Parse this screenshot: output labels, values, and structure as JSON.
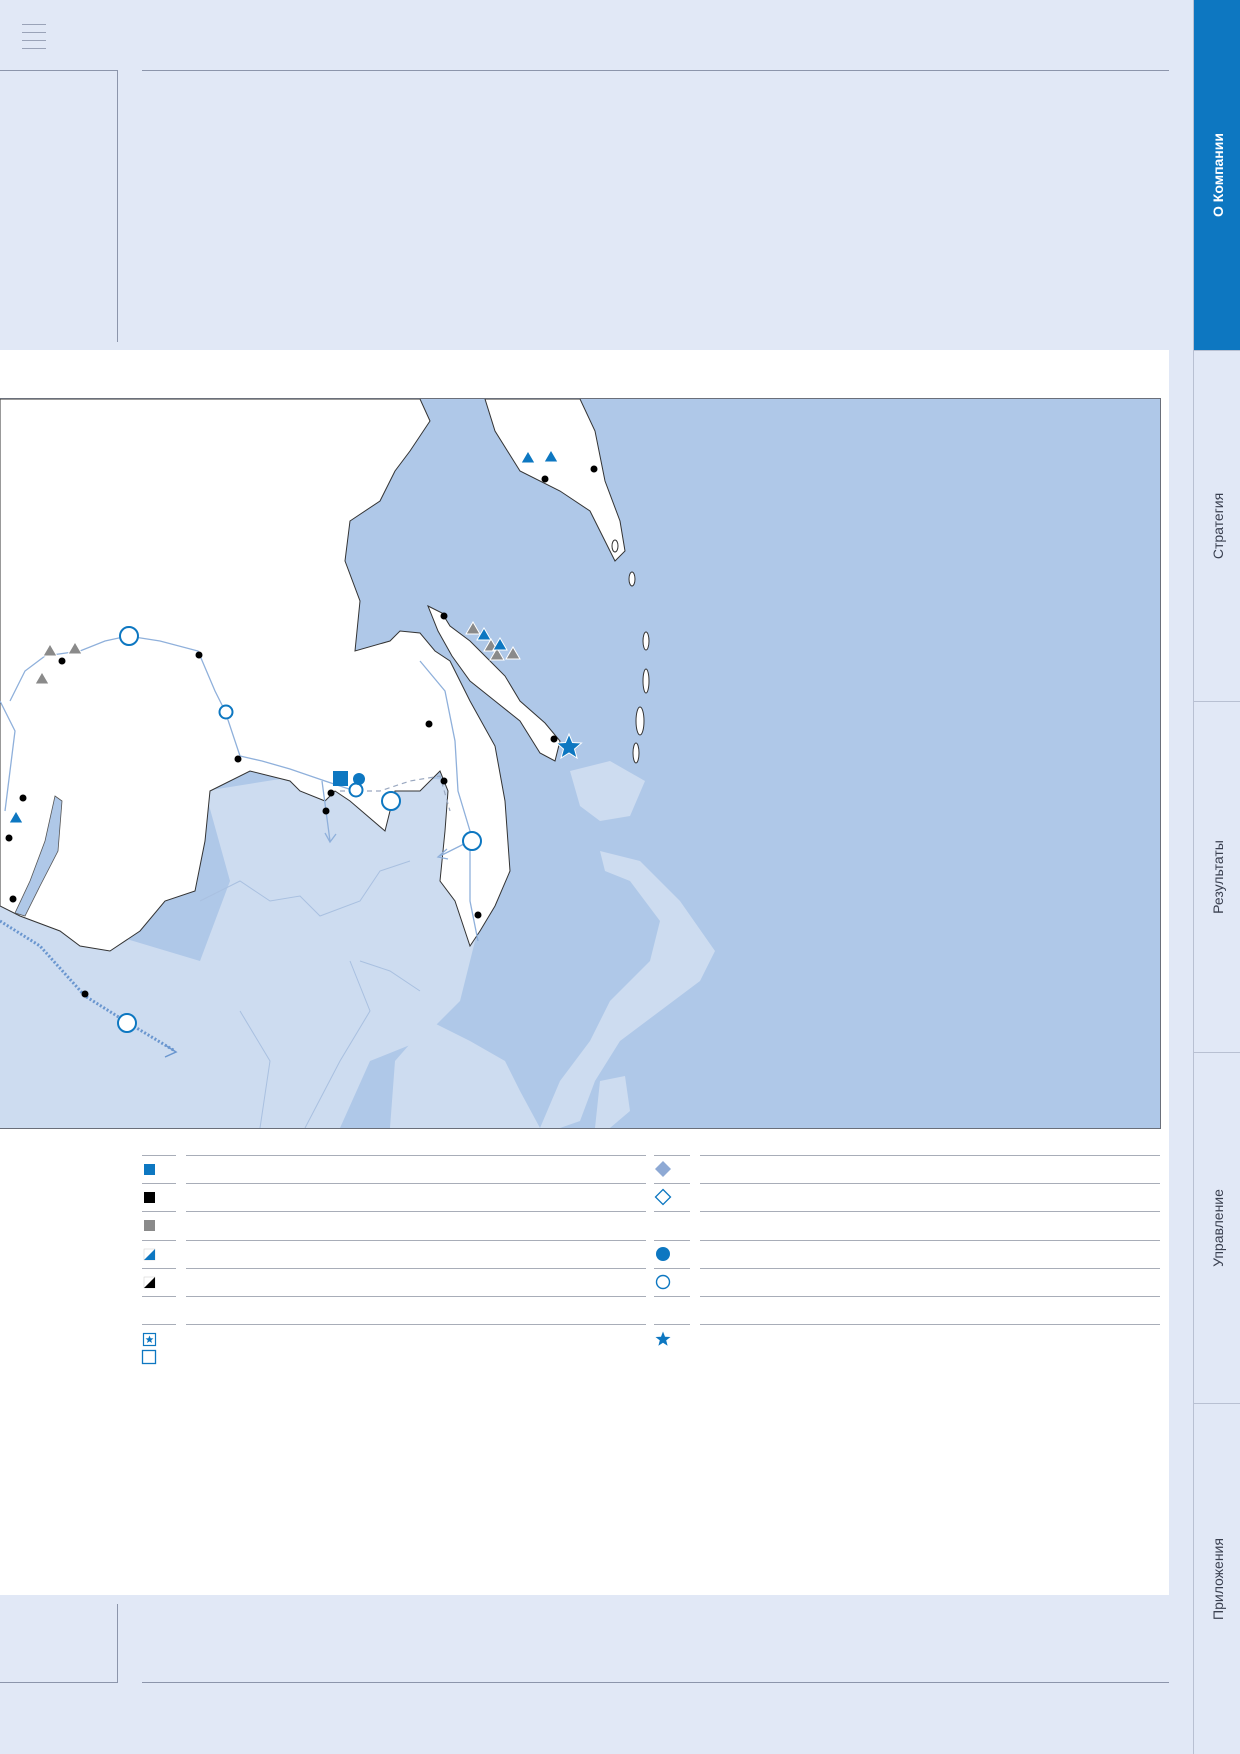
{
  "menu": {
    "icon": "hamburger-menu-icon"
  },
  "sidebar": {
    "items": [
      {
        "label": "О Компании",
        "active": true
      },
      {
        "label": "Стратегия",
        "active": false
      },
      {
        "label": "Результаты",
        "active": false
      },
      {
        "label": "Управление",
        "active": false
      },
      {
        "label": "Приложения",
        "active": false
      }
    ]
  },
  "colors": {
    "page_background": "#e1e8f6",
    "accent": "#0d77c1",
    "sea": "#afc8e8",
    "neighbor_land": "#cddcf0",
    "land": "#ffffff",
    "river": "#8fb0db",
    "symbol_grey": "#8a8a8a",
    "symbol_black": "#000000"
  },
  "map": {
    "symbols": [
      {
        "kind": "triangle",
        "color": "blue",
        "count": 5
      },
      {
        "kind": "triangle",
        "color": "grey",
        "count": 7
      },
      {
        "kind": "circle-open",
        "color": "blue",
        "count": 8
      },
      {
        "kind": "circle-filled",
        "color": "blue",
        "count": 1
      },
      {
        "kind": "square-filled",
        "color": "blue",
        "count": 1
      },
      {
        "kind": "star",
        "color": "blue",
        "count": 1
      },
      {
        "kind": "dot",
        "color": "black",
        "count": 17
      }
    ]
  },
  "legend": {
    "left_column": [
      {
        "icon": "blue-square-icon"
      },
      {
        "icon": "black-square-icon"
      },
      {
        "icon": "grey-square-icon"
      },
      {
        "icon": "blue-white-diagonal-square-icon"
      },
      {
        "icon": "black-white-diagonal-square-icon"
      },
      {
        "icon": ""
      },
      {
        "icon": "star-in-square-icon"
      },
      {
        "icon": "open-square-icon"
      }
    ],
    "right_column": [
      {
        "icon": "grey-diamond-icon"
      },
      {
        "icon": "open-diamond-icon"
      },
      {
        "icon": ""
      },
      {
        "icon": "blue-filled-circle-icon"
      },
      {
        "icon": "blue-open-circle-icon"
      },
      {
        "icon": ""
      },
      {
        "icon": "blue-star-icon"
      }
    ]
  }
}
